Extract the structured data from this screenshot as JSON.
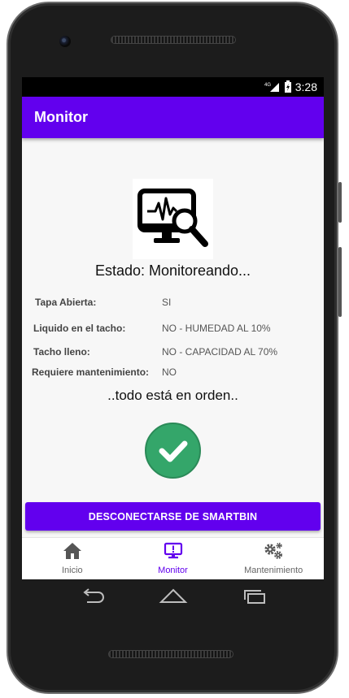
{
  "status_bar": {
    "network": "4G",
    "time": "3:28"
  },
  "app_bar": {
    "title": "Monitor"
  },
  "monitor": {
    "estado": "Estado: Monitoreando...",
    "rows": [
      {
        "label": "Tapa Abierta:",
        "value": "SI"
      },
      {
        "label": "Liquido en el tacho:",
        "value": "NO - HUMEDAD AL 10%"
      },
      {
        "label": "Tacho lleno:",
        "value": "NO - CAPACIDAD AL 70%"
      },
      {
        "label": "Requiere mantenimiento:",
        "value": "NO"
      }
    ],
    "message": "..todo está en orden..",
    "disconnect_label": "DESCONECTARSE DE SMARTBIN"
  },
  "bottom_nav": [
    {
      "label": "Inicio",
      "icon": "home-icon",
      "active": false
    },
    {
      "label": "Monitor",
      "icon": "monitor-alert-icon",
      "active": true
    },
    {
      "label": "Mantenimiento",
      "icon": "gears-icon",
      "active": false
    }
  ],
  "colors": {
    "primary": "#6200ee",
    "success": "#34a66a",
    "inactive": "#666666"
  },
  "icons": {
    "logo": "monitor-search-icon",
    "status": "check-circle-icon",
    "back": "back-icon",
    "home": "home-button-icon",
    "recents": "recents-icon"
  }
}
